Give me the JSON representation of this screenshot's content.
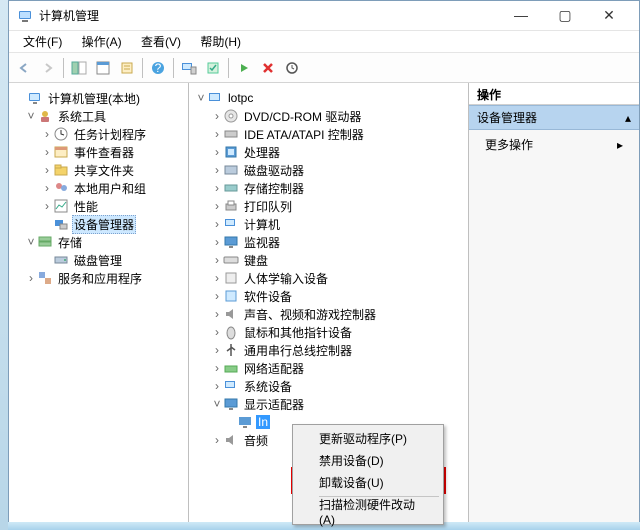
{
  "window": {
    "title": "计算机管理"
  },
  "menus": {
    "file": "文件(F)",
    "action": "操作(A)",
    "view": "查看(V)",
    "help": "帮助(H)"
  },
  "left": {
    "root": "计算机管理(本地)",
    "systools": "系统工具",
    "sched": "任务计划程序",
    "evtv": "事件查看器",
    "share": "共享文件夹",
    "users": "本地用户和组",
    "perf": "性能",
    "devmgr": "设备管理器",
    "storage": "存储",
    "diskmgr": "磁盘管理",
    "svc": "服务和应用程序"
  },
  "mid": {
    "root": "lotpc",
    "dvd": "DVD/CD-ROM 驱动器",
    "ide": "IDE ATA/ATAPI 控制器",
    "cpu": "处理器",
    "diskdrive": "磁盘驱动器",
    "storctl": "存储控制器",
    "printq": "打印队列",
    "computer": "计算机",
    "monitor": "监视器",
    "keyboard": "键盘",
    "hid": "人体学输入设备",
    "soft": "软件设备",
    "sound": "声音、视频和游戏控制器",
    "mouse": "鼠标和其他指针设备",
    "usb": "通用串行总线控制器",
    "net": "网络适配器",
    "sysdev": "系统设备",
    "display": "显示适配器",
    "gpu": "In",
    "audio": "音频"
  },
  "right": {
    "header": "操作",
    "group": "设备管理器",
    "more": "更多操作"
  },
  "ctx": {
    "update": "更新驱动程序(P)",
    "disable": "禁用设备(D)",
    "uninstall": "卸载设备(U)",
    "scan": "扫描检测硬件改动(A)"
  }
}
